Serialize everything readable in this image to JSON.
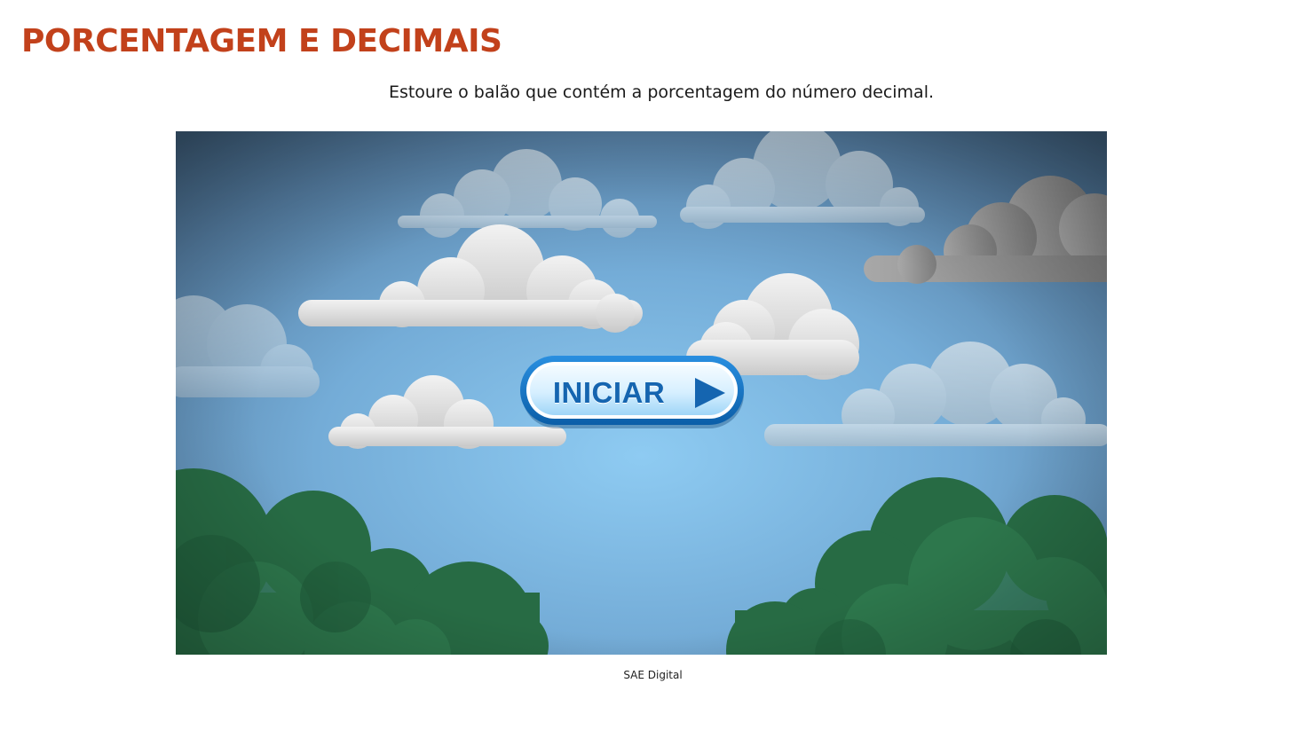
{
  "page": {
    "title": "PORCENTAGEM E DECIMAIS",
    "instruction": "Estoure o balão que contém a porcentagem do número decimal.",
    "caption": "SAE Digital"
  },
  "game": {
    "start_button_label": "INICIAR",
    "start_button_icon": "play-arrow-icon",
    "scene": "sky-with-clouds-and-trees"
  },
  "colors": {
    "title": "#c2411b",
    "button_text": "#1565b0",
    "sky_center": "#8ecbf2",
    "sky_edge": "#3f5f7c",
    "tree_green": "#276b44",
    "cloud": "#e6e6e6"
  }
}
